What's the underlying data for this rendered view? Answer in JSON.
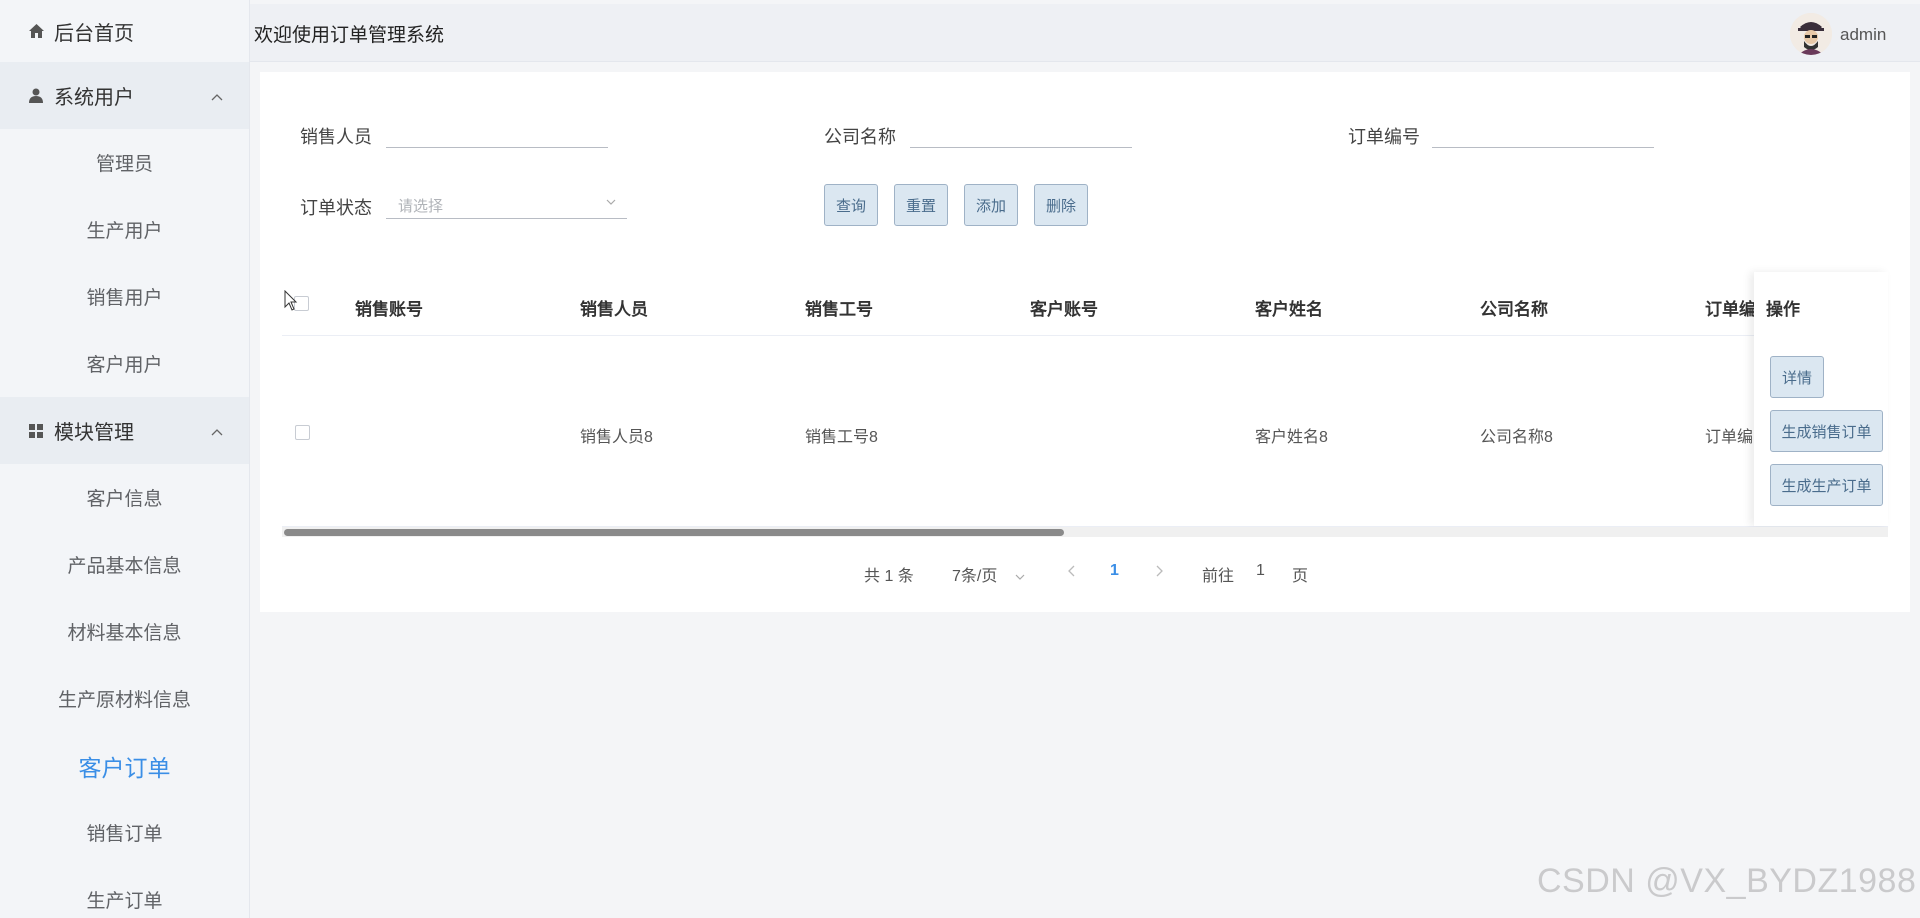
{
  "sidebar": {
    "home": "后台首页",
    "group_users": "系统用户",
    "users": [
      "管理员",
      "生产用户",
      "销售用户",
      "客户用户"
    ],
    "group_modules": "模块管理",
    "modules": [
      "客户信息",
      "产品基本信息",
      "材料基本信息",
      "生产原材料信息",
      "客户订单",
      "销售订单",
      "生产订单"
    ],
    "active_item": "客户订单"
  },
  "header": {
    "title": "欢迎使用订单管理系统",
    "username": "admin"
  },
  "search": {
    "salesperson_label": "销售人员",
    "company_label": "公司名称",
    "order_no_label": "订单编号",
    "status_label": "订单状态",
    "status_placeholder": "请选择",
    "query_button": "查询",
    "reset_button": "重置",
    "add_button": "添加",
    "delete_button": "删除"
  },
  "table": {
    "columns": [
      "销售账号",
      "销售人员",
      "销售工号",
      "客户账号",
      "客户姓名",
      "公司名称",
      "订单编"
    ],
    "op_header": "操作",
    "rows": [
      {
        "sales_account": "",
        "salesperson": "销售人员8",
        "sales_id": "销售工号8",
        "customer_account": "",
        "customer_name": "客户姓名8",
        "company": "公司名称8",
        "order_no": "订单编"
      }
    ],
    "op_buttons": [
      "详情",
      "生成销售订单",
      "生成生产订单"
    ]
  },
  "pagination": {
    "total": "共 1 条",
    "page_size": "7条/页",
    "current_page": "1",
    "goto_label": "前往",
    "goto_value": "1",
    "page_suffix": "页"
  },
  "watermark": "CSDN @VX_BYDZ1988",
  "colors": {
    "accent": "#3a8ee6",
    "button_bg": "#dbe7f1",
    "button_text": "#4a6c8c"
  }
}
